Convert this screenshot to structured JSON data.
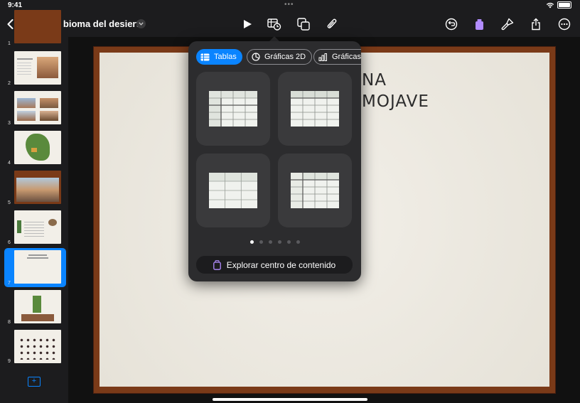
{
  "status": {
    "time": "9:41"
  },
  "toolbar": {
    "document_title": "El bioma del desierto"
  },
  "sidebar": {
    "slide_numbers": [
      "1",
      "2",
      "3",
      "4",
      "5",
      "6",
      "7",
      "8",
      "9"
    ]
  },
  "slide": {
    "title_line1": "NA",
    "title_line2": "MOJAVE"
  },
  "popover": {
    "tabs": [
      {
        "label": "Tablas",
        "icon": "table-icon"
      },
      {
        "label": "Gráficas 2D",
        "icon": "chart-2d-icon"
      },
      {
        "label": "Gráficas",
        "icon": "chart-3d-icon"
      }
    ],
    "explore_label": "Explorar centro de contenido",
    "page_count": 6,
    "current_page": 1
  },
  "colors": {
    "accent": "#0a84ff",
    "popover_bg": "#2c2c2e",
    "card_bg": "#3a3a3c",
    "slide_frame": "#7a3a18"
  }
}
